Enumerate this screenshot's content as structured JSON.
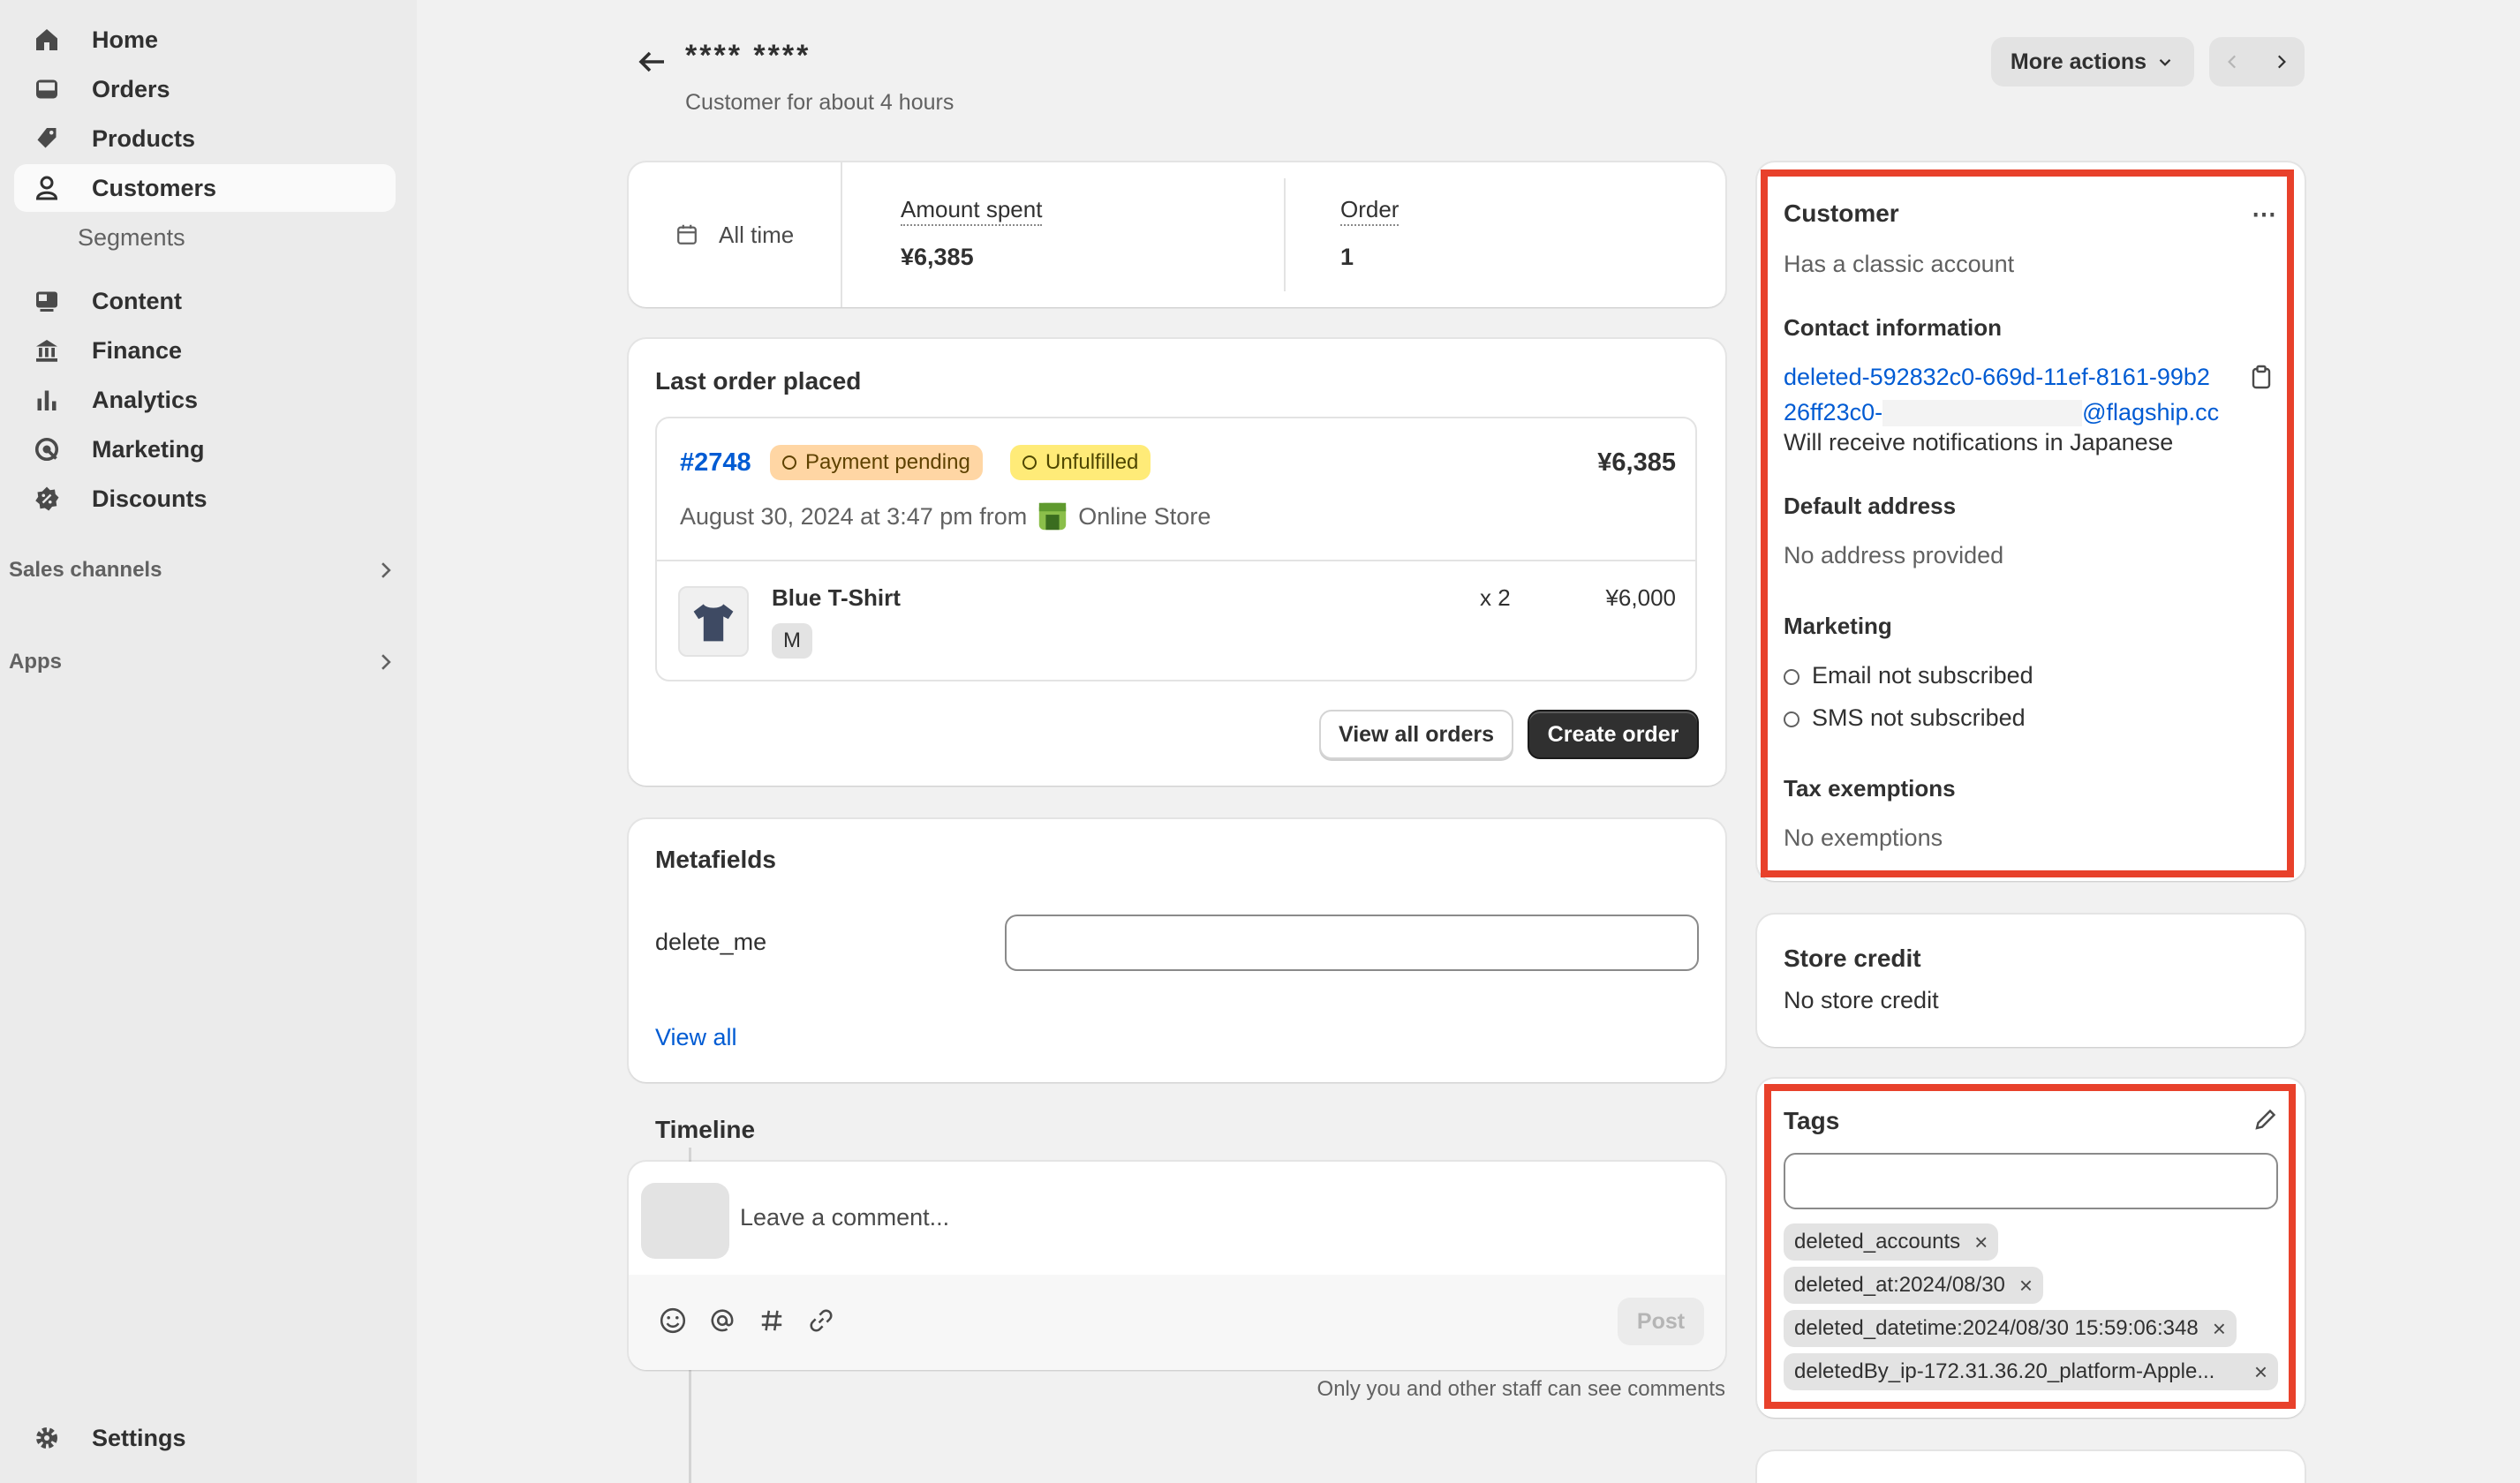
{
  "sidebar": {
    "items": [
      {
        "label": "Home",
        "icon": "home-icon"
      },
      {
        "label": "Orders",
        "icon": "inbox-icon"
      },
      {
        "label": "Products",
        "icon": "tag-icon"
      },
      {
        "label": "Customers",
        "icon": "person-icon"
      },
      {
        "label": "Content",
        "icon": "content-icon"
      },
      {
        "label": "Finance",
        "icon": "bank-icon"
      },
      {
        "label": "Analytics",
        "icon": "bar-chart-icon"
      },
      {
        "label": "Marketing",
        "icon": "target-icon"
      },
      {
        "label": "Discounts",
        "icon": "discount-icon"
      }
    ],
    "sub_segments": "Segments",
    "sales_channels": "Sales channels",
    "apps": "Apps",
    "settings": "Settings"
  },
  "header": {
    "name": "**** ****",
    "since": "Customer for about 4 hours",
    "more_actions": "More actions"
  },
  "stats": {
    "period": "All time",
    "amount_label": "Amount spent",
    "amount_value": "¥6,385",
    "order_label": "Order",
    "order_value": "1"
  },
  "last_order": {
    "title": "Last order placed",
    "number": "#2748",
    "payment_badge": "Payment pending",
    "fulfillment_badge": "Unfulfilled",
    "total": "¥6,385",
    "date": "August 30, 2024 at 3:47 pm from",
    "channel": "Online Store",
    "item_name": "Blue T-Shirt",
    "item_variant": "M",
    "item_qty": "x 2",
    "item_price": "¥6,000",
    "view_all": "View all orders",
    "create": "Create order"
  },
  "metafields": {
    "title": "Metafields",
    "field_label": "delete_me",
    "field_value": "",
    "view_all": "View all"
  },
  "timeline": {
    "title": "Timeline",
    "placeholder": "Leave a comment...",
    "post": "Post",
    "note": "Only you and other staff can see comments"
  },
  "customer_card": {
    "title": "Customer",
    "account": "Has a classic account",
    "contact_title": "Contact information",
    "email_line1": "deleted-592832c0-669d-11ef-8161-99b2",
    "email_line2_start": "26ff23c0-",
    "email_line2_end": "@flagship.cc",
    "notifications": "Will receive notifications in Japanese",
    "address_title": "Default address",
    "address": "No address provided",
    "marketing_title": "Marketing",
    "email_marketing": "Email not subscribed",
    "sms_marketing": "SMS not subscribed",
    "tax_title": "Tax exemptions",
    "tax": "No exemptions"
  },
  "store_credit": {
    "title": "Store credit",
    "value": "No store credit"
  },
  "tags_card": {
    "title": "Tags",
    "input_value": "",
    "tags": [
      "deleted_accounts",
      "deleted_at:2024/08/30",
      "deleted_datetime:2024/08/30 15:59:06:348",
      "deletedBy_ip-172.31.36.20_platform-Apple..."
    ]
  },
  "colors": {
    "highlight": "#e8412b",
    "link": "#005bd3",
    "payment_badge_bg": "#ffd6a4",
    "fulfillment_badge_bg": "#ffeb78"
  }
}
